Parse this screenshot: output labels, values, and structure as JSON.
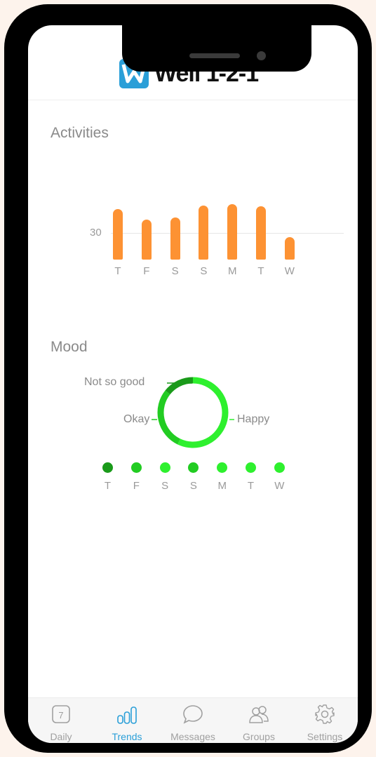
{
  "app": {
    "title": "Well 1-2-1"
  },
  "activities": {
    "title": "Activities",
    "tick_label": "30"
  },
  "mood": {
    "title": "Mood",
    "labels": {
      "not_so_good": "Not so good",
      "okay": "Okay",
      "happy": "Happy"
    },
    "days": [
      {
        "day": "T",
        "level": "Not so good"
      },
      {
        "day": "F",
        "level": "Okay"
      },
      {
        "day": "S",
        "level": "Happy"
      },
      {
        "day": "S",
        "level": "Okay"
      },
      {
        "day": "M",
        "level": "Happy"
      },
      {
        "day": "T",
        "level": "Happy"
      },
      {
        "day": "W",
        "level": "Happy"
      }
    ]
  },
  "chart_data": [
    {
      "type": "bar",
      "title": "Activities",
      "categories": [
        "T",
        "F",
        "S",
        "S",
        "M",
        "T",
        "W"
      ],
      "values": [
        57,
        45,
        47,
        61,
        62,
        60,
        25
      ],
      "ytick": 30,
      "color": "#fd9233"
    },
    {
      "type": "pie",
      "title": "Mood",
      "categories": [
        "Happy",
        "Okay",
        "Not so good"
      ],
      "values": [
        4,
        2,
        1
      ],
      "colors": [
        "#2ef02e",
        "#22cc22",
        "#1a9a1a"
      ]
    }
  ],
  "colors": {
    "accent": "#2a9fd8",
    "bar": "#fd9233",
    "mood_happy": "#2ef02e",
    "mood_okay": "#22cc22",
    "mood_not_so_good": "#1a9a1a"
  },
  "tabs": [
    {
      "label": "Daily",
      "icon": "calendar-icon",
      "badge": "7"
    },
    {
      "label": "Trends",
      "icon": "bar-chart-icon",
      "active": true
    },
    {
      "label": "Messages",
      "icon": "chat-bubble-icon"
    },
    {
      "label": "Groups",
      "icon": "people-icon"
    },
    {
      "label": "Settings",
      "icon": "gear-icon"
    }
  ]
}
